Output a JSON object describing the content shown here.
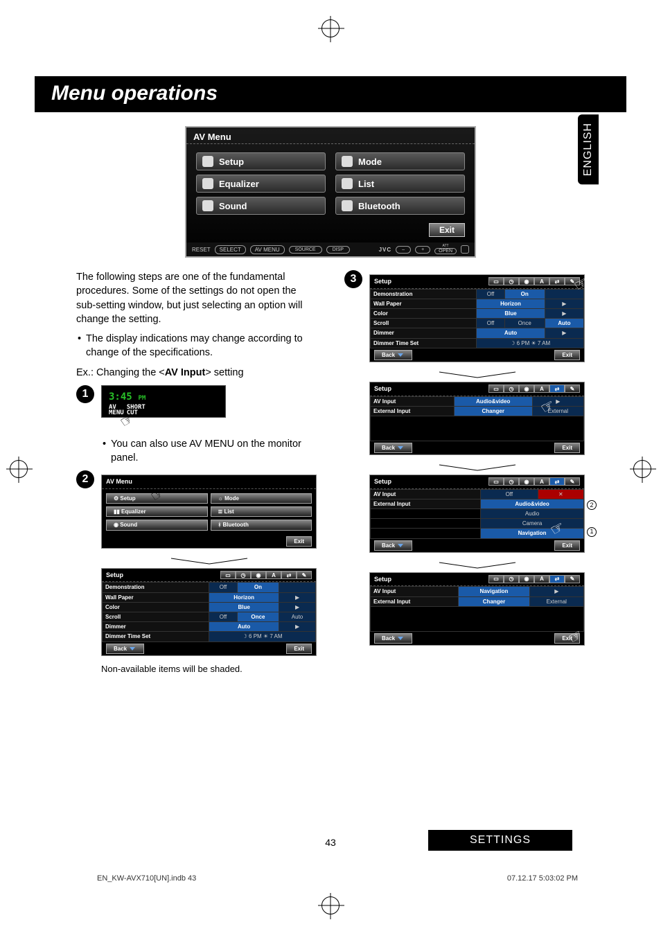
{
  "language_tab": "ENGLISH",
  "title": "Menu operations",
  "av_menu": {
    "title": "AV Menu",
    "items": [
      "Setup",
      "Mode",
      "Equalizer",
      "List",
      "Sound",
      "Bluetooth"
    ],
    "exit": "Exit"
  },
  "panel": {
    "labels": [
      "RESET",
      "SELECT",
      "AV MENU"
    ],
    "buttons": [
      "SOURCE",
      "DISP"
    ],
    "brand": "JVC",
    "minus": "–",
    "plus": "+",
    "att": "ATT",
    "open": "OPEN"
  },
  "intro": {
    "p1": "The following steps are one of the fundamental procedures. Some of the settings do not open the sub-setting window, but just selecting an option will change the setting.",
    "b1": "The display indications may change according to change of the specifications.",
    "example_prefix": "Ex.: Changing the <",
    "example_bold": "AV Input",
    "example_suffix": "> setting"
  },
  "step1": {
    "num": "1",
    "time": "3:45",
    "ampm": "PM",
    "line1a": "AV",
    "line1b": "MENU",
    "line2a": "SHORT",
    "line2b": "CUT"
  },
  "step2": {
    "num": "2",
    "note": "You can also use AV MENU on the monitor panel.",
    "menu_title": "AV Menu",
    "items": [
      "Setup",
      "Mode",
      "Equalizer",
      "List",
      "Sound",
      "Bluetooth"
    ],
    "exit": "Exit"
  },
  "setup_screen_a": {
    "title": "Setup",
    "rows": [
      {
        "label": "Demonstration",
        "opts": [
          "Off",
          "On"
        ],
        "sel": 1
      },
      {
        "label": "Wall Paper",
        "opts": [
          "Horizon"
        ],
        "arrow": true
      },
      {
        "label": "Color",
        "opts": [
          "Blue"
        ],
        "arrow": true
      },
      {
        "label": "Scroll",
        "opts": [
          "Off",
          "Once",
          "Auto"
        ],
        "sel": 1
      },
      {
        "label": "Dimmer",
        "opts": [
          "Auto"
        ],
        "arrow": true
      },
      {
        "label": "Dimmer Time Set",
        "opts": [
          "☽ 6 PM  ☀ 7 AM"
        ]
      }
    ],
    "back": "Back",
    "exit": "Exit"
  },
  "caption_shaded": "Non-available items will be shaded.",
  "step3": {
    "num": "3"
  },
  "setup_screen_b": {
    "title": "Setup",
    "rows": [
      {
        "label": "Demonstration",
        "opts": [
          "Off",
          "On"
        ],
        "sel": 1
      },
      {
        "label": "Wall Paper",
        "opts": [
          "Horizon"
        ],
        "arrow": true
      },
      {
        "label": "Color",
        "opts": [
          "Blue"
        ],
        "arrow": true
      },
      {
        "label": "Scroll",
        "opts": [
          "Off",
          "Once",
          "Auto"
        ],
        "sel": 2
      },
      {
        "label": "Dimmer",
        "opts": [
          "Auto"
        ],
        "arrow": true
      },
      {
        "label": "Dimmer Time Set",
        "opts": [
          "☽ 6 PM  ☀ 7 AM"
        ]
      }
    ],
    "back": "Back",
    "exit": "Exit"
  },
  "setup_screen_c": {
    "title": "Setup",
    "rows": [
      {
        "label": "AV Input",
        "opts": [
          "Audio&video"
        ],
        "sel": 0,
        "arrow": true
      },
      {
        "label": "External Input",
        "opts": [
          "Changer",
          "External"
        ],
        "sel": 0
      }
    ],
    "back": "Back",
    "exit": "Exit"
  },
  "setup_screen_d": {
    "title": "Setup",
    "rows": [
      {
        "label": "AV Input",
        "opts": [
          "Off"
        ]
      },
      {
        "label": "External Input",
        "opts": [
          "Audio&video"
        ],
        "sel": 0
      }
    ],
    "dropdown": [
      "Audio",
      "Camera",
      "Navigation"
    ],
    "back": "Back",
    "exit": "Exit",
    "callout1": "1",
    "callout2": "2"
  },
  "setup_screen_e": {
    "title": "Setup",
    "rows": [
      {
        "label": "AV Input",
        "opts": [
          "Navigation"
        ],
        "sel": 0,
        "arrow": true
      },
      {
        "label": "External Input",
        "opts": [
          "Changer",
          "External"
        ],
        "sel": 0
      }
    ],
    "back": "Back",
    "exit": "Exit"
  },
  "footer": {
    "section": "SETTINGS",
    "page": "43",
    "file": "EN_KW-AVX710[UN].indb   43",
    "timestamp": "07.12.17   5:03:02 PM"
  }
}
